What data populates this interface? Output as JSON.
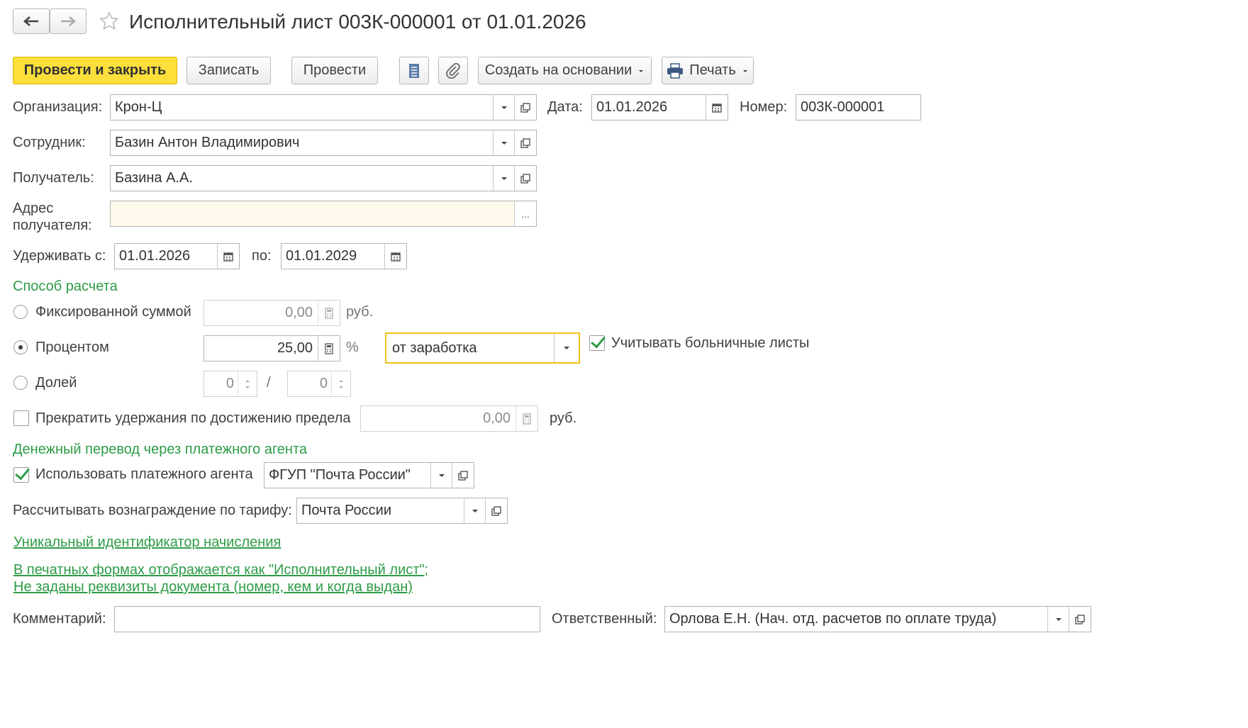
{
  "window": {
    "title": "Исполнительный лист 003К-000001 от 01.01.2026"
  },
  "toolbar": {
    "post_close": "Провести и закрыть",
    "save": "Записать",
    "post": "Провести",
    "create_based": "Создать на основании",
    "print": "Печать"
  },
  "form": {
    "organization_label": "Организация:",
    "organization_value": "Крон-Ц",
    "date_label": "Дата:",
    "date_value": "01.01.2026",
    "number_label": "Номер:",
    "number_value": "003К-000001",
    "employee_label": "Сотрудник:",
    "employee_value": "Базин Антон Владимирович",
    "recipient_label": "Получатель:",
    "recipient_value": "Базина А.А.",
    "address_label_1": "Адрес",
    "address_label_2": "получателя:",
    "address_value": "",
    "address_button": "...",
    "withhold_from_label": "Удерживать с:",
    "withhold_from_value": "01.01.2026",
    "withhold_to_label": "по:",
    "withhold_to_value": "01.01.2029"
  },
  "calc": {
    "section_title": "Способ расчета",
    "fixed_label": "Фиксированной суммой",
    "fixed_value": "0,00",
    "fixed_unit": "руб.",
    "percent_label": "Процентом",
    "percent_value": "25,00",
    "percent_unit": "%",
    "base_value": "от заработка",
    "sick_leave_label": "Учитывать больничные листы",
    "share_label": "Долей",
    "share_num": "0",
    "share_sep": "/",
    "share_den": "0",
    "limit_label": "Прекратить удержания по достижению предела",
    "limit_value": "0,00",
    "limit_unit": "руб."
  },
  "transfer": {
    "section_title": "Денежный перевод через платежного агента",
    "use_agent_label": "Использовать платежного агента",
    "agent_value": "ФГУП \"Почта России\"",
    "tariff_label": "Рассчитывать вознаграждение по тарифу:",
    "tariff_value": "Почта России"
  },
  "links": {
    "uid": "Уникальный идентификатор начисления",
    "print_forms_1": "В печатных формах отображается как \"Исполнительный лист\";",
    "print_forms_2": "Не заданы реквизиты документа (номер, кем и когда выдан)"
  },
  "footer": {
    "comment_label": "Комментарий:",
    "comment_value": "",
    "responsible_label": "Ответственный:",
    "responsible_value": "Орлова Е.Н. (Нач. отд. расчетов по оплате труда)"
  },
  "state": {
    "radio_selected": "percent",
    "sick_leave_checked": true,
    "limit_checked": false,
    "use_agent_checked": true
  },
  "colors": {
    "accent_yellow": "#fcdf3b",
    "section_green": "#2e9c47",
    "focus_border": "#f2c21b",
    "address_bg": "#fff9ec"
  },
  "icons": [
    "back-arrow-icon",
    "forward-arrow-icon",
    "star-icon",
    "document-list-icon",
    "paperclip-icon",
    "printer-icon",
    "calendar-icon",
    "calculator-icon",
    "dropdown-arrow-icon",
    "open-form-icon",
    "spinner-icon"
  ]
}
